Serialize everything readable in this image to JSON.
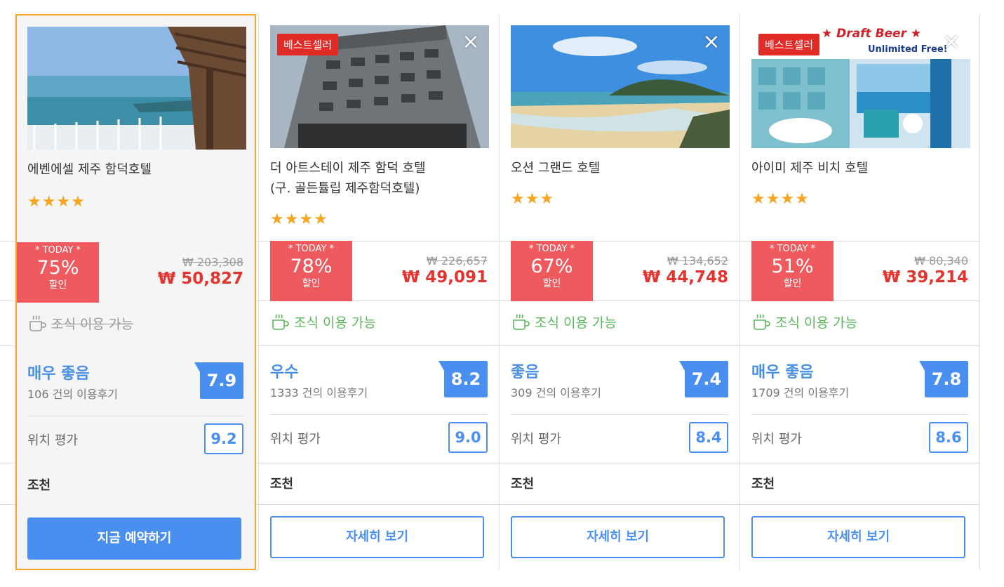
{
  "hotels": [
    {
      "name": "에벤에셀 제주 함덕호텔",
      "stars": "★★★★",
      "badge": "",
      "deal": {
        "today": "* TODAY *",
        "percent": "75%",
        "sale": "할인"
      },
      "original_price": "₩ 203,308",
      "price": "₩ 50,827",
      "breakfast": "조식 이용 가능",
      "breakfast_available": false,
      "rating_label": "매우 좋음",
      "reviews": "106 건의 이용후기",
      "score": "7.9",
      "location_label": "위치 평가",
      "location_score": "9.2",
      "meal": "조천",
      "button": "지금 예약하기",
      "image_icon": "coastal-terrace-photo"
    },
    {
      "name": "더 아트스테이 제주 함덕 호텔",
      "name2": "(구. 골든튤립 제주함덕호텔)",
      "stars": "★★★★",
      "badge": "베스트셀러",
      "deal": {
        "today": "* TODAY *",
        "percent": "78%",
        "sale": "할인"
      },
      "original_price": "₩ 226,657",
      "price": "₩ 49,091",
      "breakfast": "조식 이용 가능",
      "breakfast_available": true,
      "rating_label": "우수",
      "reviews": "1333 건의 이용후기",
      "score": "8.2",
      "location_label": "위치 평가",
      "location_score": "9.0",
      "meal": "조천",
      "button": "자세히 보기",
      "image_icon": "hotel-building-photo"
    },
    {
      "name": "오션 그랜드 호텔",
      "stars": "★★★",
      "badge": "",
      "deal": {
        "today": "* TODAY *",
        "percent": "67%",
        "sale": "할인"
      },
      "original_price": "₩ 134,652",
      "price": "₩ 44,748",
      "breakfast": "조식 이용 가능",
      "breakfast_available": true,
      "rating_label": "좋음",
      "reviews": "309 건의 이용후기",
      "score": "7.4",
      "location_label": "위치 평가",
      "location_score": "8.4",
      "meal": "조천",
      "button": "자세히 보기",
      "image_icon": "beach-photo"
    },
    {
      "name": "아이미 제주 비치 호텔",
      "stars": "★★★★",
      "badge": "베스트셀러",
      "image_text": [
        "★ Draft Beer ★",
        "Unlimited Free!"
      ],
      "deal": {
        "today": "* TODAY *",
        "percent": "51%",
        "sale": "할인"
      },
      "original_price": "₩ 80,340",
      "price": "₩ 39,214",
      "breakfast": "조식 이용 가능",
      "breakfast_available": true,
      "rating_label": "매우 좋음",
      "reviews": "1709 건의 이용후기",
      "score": "7.8",
      "location_label": "위치 평가",
      "location_score": "8.6",
      "meal": "조천",
      "button": "자세히 보기",
      "image_icon": "bathroom-sea-view-photo"
    }
  ],
  "colors": {
    "accent_blue": "#4a8ff0",
    "deal_red": "#ef5a5f",
    "price_red": "#e3342f",
    "badge_red": "#e02b27",
    "star": "#f5a623",
    "breakfast_green": "#5cb85c",
    "selected_border": "#f5a623"
  }
}
